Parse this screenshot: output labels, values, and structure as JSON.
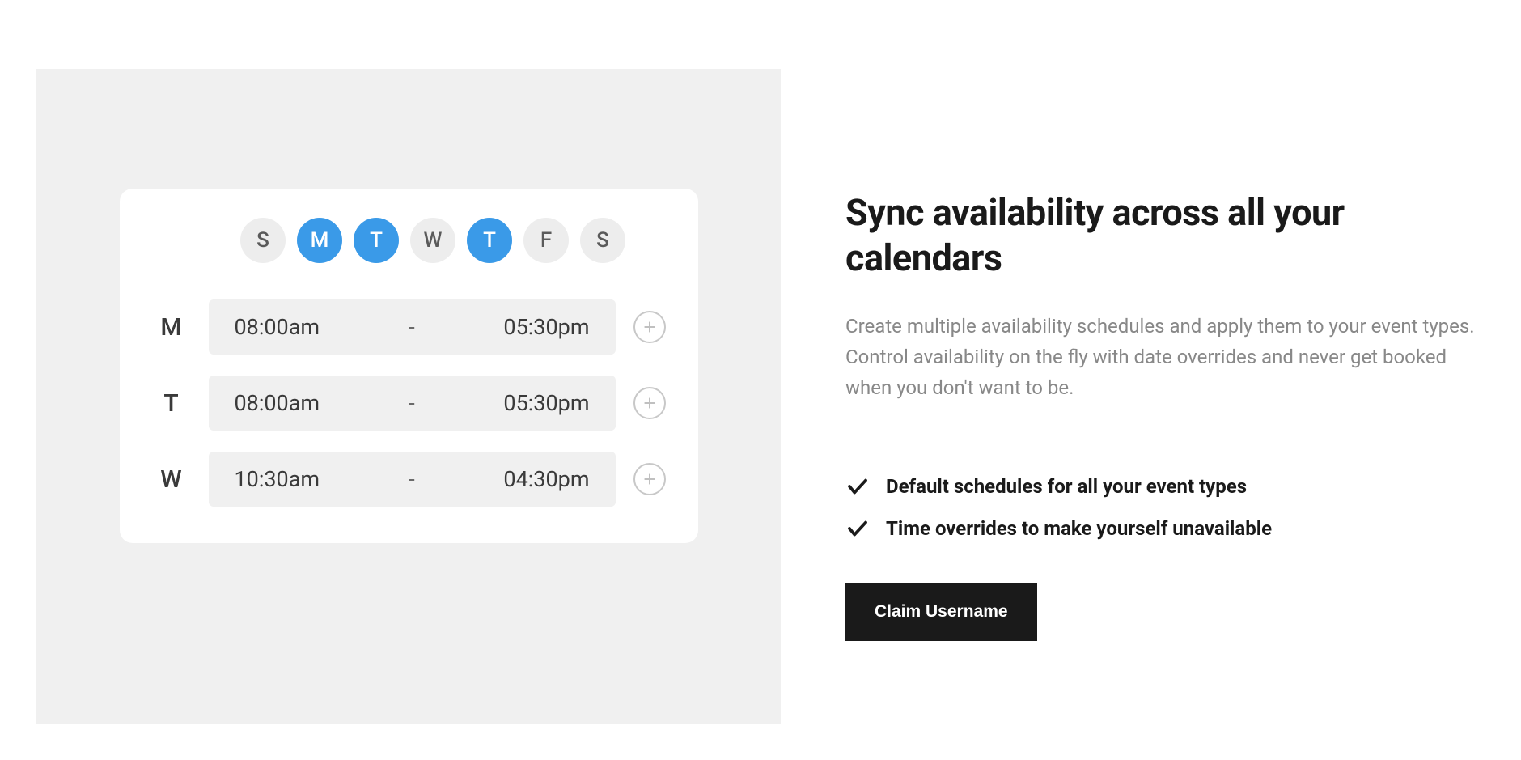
{
  "calendar": {
    "days": [
      {
        "label": "S",
        "selected": false
      },
      {
        "label": "M",
        "selected": true
      },
      {
        "label": "T",
        "selected": true
      },
      {
        "label": "W",
        "selected": false
      },
      {
        "label": "T",
        "selected": true
      },
      {
        "label": "F",
        "selected": false
      },
      {
        "label": "S",
        "selected": false
      }
    ],
    "rows": [
      {
        "day": "M",
        "start": "08:00am",
        "end": "05:30pm"
      },
      {
        "day": "T",
        "start": "08:00am",
        "end": "05:30pm"
      },
      {
        "day": "W",
        "start": "10:30am",
        "end": "04:30pm"
      }
    ]
  },
  "content": {
    "heading": "Sync availability across all your calendars",
    "description": "Create multiple availability schedules and apply them to your event types. Control availability on the fly with date overrides and never get booked when you don't want to be.",
    "features": [
      "Default schedules for all your event types",
      "Time overrides to make yourself unavailable"
    ],
    "cta_label": "Claim Username"
  }
}
